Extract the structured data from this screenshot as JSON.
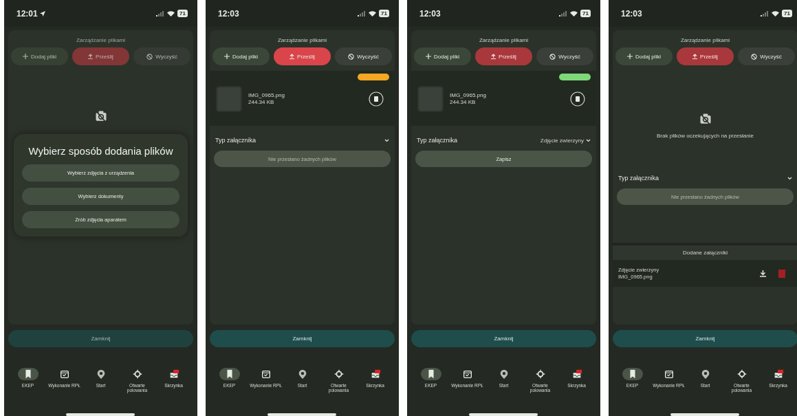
{
  "phones": [
    {
      "time": "12:01",
      "location_arrow": true,
      "battery": "71",
      "dimmed": true,
      "title": "Zarządzanie plikami",
      "actions": [
        {
          "kind": "add",
          "label": "Dodaj pliki",
          "disabled": false
        },
        {
          "kind": "upload",
          "label": "Prześlij",
          "disabled": true
        },
        {
          "kind": "clear",
          "label": "Wyczyść",
          "disabled": false
        }
      ],
      "content": {
        "kind": "picker",
        "title": "Wybierz sposób dodania plików",
        "options": [
          "Wybierz zdjęcia z urządzenia",
          "Wybierz dokumenty",
          "Zrób zdjęcia aparatem"
        ]
      },
      "close_label": "Zamknij",
      "nav": [
        {
          "label": "EKEP",
          "selected": true
        },
        {
          "label": "Wykonanie RPŁ",
          "selected": false
        },
        {
          "label": "Start",
          "selected": false
        },
        {
          "label": "Otwarte polowania",
          "selected": false
        },
        {
          "label": "Skrzynka",
          "selected": false
        }
      ]
    },
    {
      "time": "12:03",
      "location_arrow": false,
      "battery": "71",
      "dimmed": false,
      "title": "Zarządzanie plikami",
      "actions": [
        {
          "kind": "add",
          "label": "Dodaj pliki",
          "disabled": false
        },
        {
          "kind": "upload",
          "label": "Prześlij",
          "disabled": false
        },
        {
          "kind": "clear",
          "label": "Wyczyść",
          "disabled": false
        }
      ],
      "content": {
        "kind": "file",
        "file": {
          "name": "IMG_0965.png",
          "size": "244.34 KB",
          "color": "#f5a623"
        },
        "type_label": "Typ załącznika",
        "submit": {
          "label": "Nie przesłano żadnych plików",
          "disabled": true
        }
      },
      "close_label": "Zamknij",
      "nav": [
        {
          "label": "EKEP",
          "selected": true
        },
        {
          "label": "Wykonanie RPŁ",
          "selected": false
        },
        {
          "label": "Start",
          "selected": false
        },
        {
          "label": "Otwarte polowania",
          "selected": false
        },
        {
          "label": "Skrzynka",
          "selected": false
        }
      ]
    },
    {
      "time": "12:03",
      "location_arrow": false,
      "battery": "71",
      "dimmed": false,
      "title": "Zarządzanie plikami",
      "actions": [
        {
          "kind": "add",
          "label": "Dodaj pliki",
          "disabled": false
        },
        {
          "kind": "upload",
          "label": "Prześlij",
          "disabled": true
        },
        {
          "kind": "clear",
          "label": "Wyczyść",
          "disabled": false
        }
      ],
      "content": {
        "kind": "file",
        "file": {
          "name": "IMG_0965.png",
          "size": "244.34 KB",
          "color": "#7ed87a"
        },
        "type_label": "Typ załącznika",
        "type_value": "Zdjęcie zwierzyny",
        "submit": {
          "label": "Zapisz",
          "disabled": false
        }
      },
      "close_label": "Zamknij",
      "nav": [
        {
          "label": "EKEP",
          "selected": true
        },
        {
          "label": "Wykonanie RPŁ",
          "selected": false
        },
        {
          "label": "Start",
          "selected": false
        },
        {
          "label": "Otwarte polowania",
          "selected": false
        },
        {
          "label": "Skrzynka",
          "selected": false
        }
      ]
    },
    {
      "time": "12:03",
      "location_arrow": false,
      "battery": "71",
      "dimmed": false,
      "title": "Zarządzanie plikami",
      "actions": [
        {
          "kind": "add",
          "label": "Dodaj pliki",
          "disabled": false
        },
        {
          "kind": "upload",
          "label": "Prześlij",
          "disabled": true
        },
        {
          "kind": "clear",
          "label": "Wyczyść",
          "disabled": false
        }
      ],
      "content": {
        "kind": "empty",
        "message": "Brak plików oczekujących na przesłanie",
        "type_label": "Typ załącznika",
        "submit": {
          "label": "Nie przesłano żadnych plików",
          "disabled": true
        },
        "added": {
          "title": "Dodane załączniki",
          "items": [
            {
              "type": "Zdjęcie zwierzyny",
              "name": "IMG_0965.png"
            }
          ]
        }
      },
      "close_label": "Zamknij",
      "nav": [
        {
          "label": "EKEP",
          "selected": true
        },
        {
          "label": "Wykonanie RPŁ",
          "selected": false
        },
        {
          "label": "Start",
          "selected": false
        },
        {
          "label": "Otwarte polowania",
          "selected": false
        },
        {
          "label": "Skrzynka",
          "selected": false
        }
      ]
    }
  ]
}
